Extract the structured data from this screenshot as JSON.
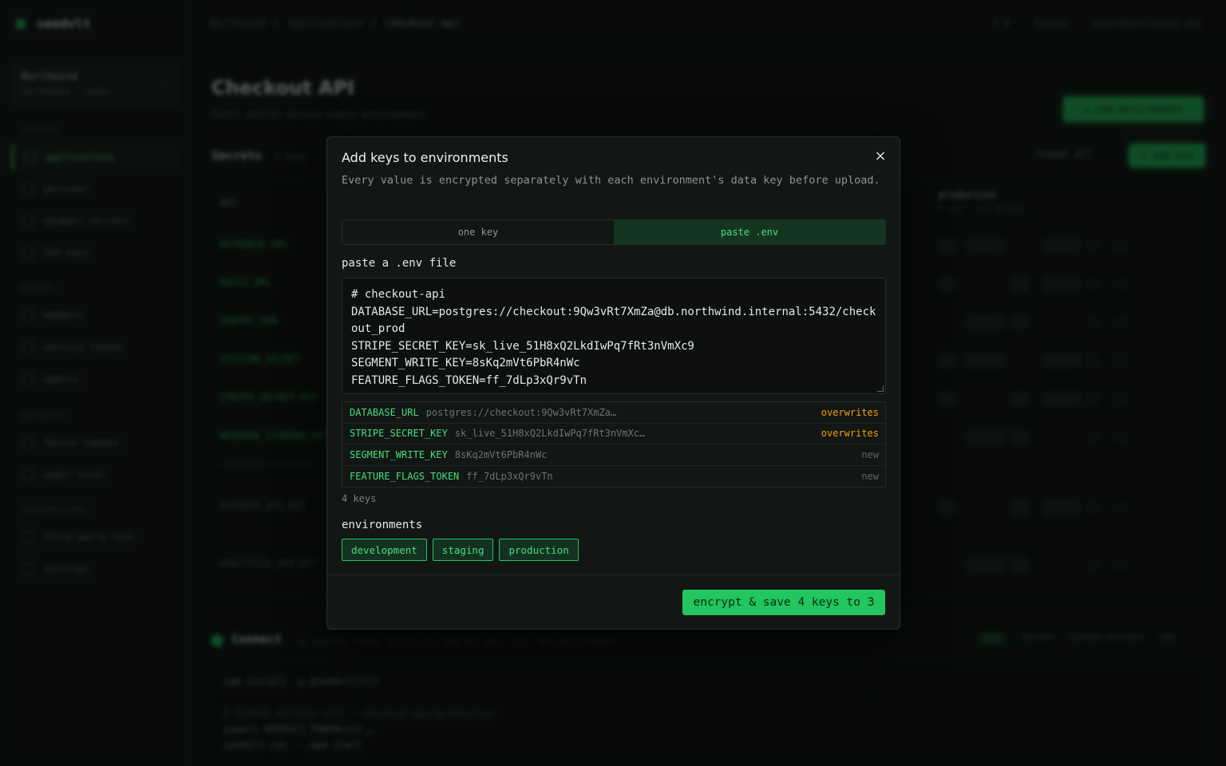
{
  "app": {
    "brand": "seedvlt",
    "org_name": "Northwind",
    "org_sub": "northwind · owner"
  },
  "sidebar": {
    "sections": [
      {
        "title": "SECRETS",
        "items": [
          {
            "label": "applications",
            "active": true
          },
          {
            "label": "personal"
          },
          {
            "label": "dynamic secrets"
          },
          {
            "label": "SSH keys"
          }
        ]
      },
      {
        "title": "ACCESS",
        "items": [
          {
            "label": "members"
          },
          {
            "label": "service tokens"
          },
          {
            "label": "agents"
          }
        ]
      },
      {
        "title": "SECURITY",
        "items": [
          {
            "label": "falcon tokens"
          },
          {
            "label": "audit trail"
          }
        ]
      },
      {
        "title": "INTEGRATIONS",
        "items": [
          {
            "label": "third-party sync"
          },
          {
            "label": "settings"
          }
        ]
      }
    ]
  },
  "topbar": {
    "crumbs": [
      "Northwind",
      "/",
      "applications",
      "/",
      "checkout-api"
    ],
    "right": [
      "⌘ K",
      "tunnel",
      "owner@northwind.dev"
    ]
  },
  "page": {
    "title": "Checkout API",
    "subtitle": "Every secret across every environment.",
    "new_env_button": "+ new environment",
    "secrets_title": "Secrets",
    "secrets_count": "6 keys",
    "reveal_all": "reveal all",
    "add_key_button": "+ add key",
    "table_key_header": "KEY",
    "prod_header": "production",
    "prod_sub": "1 env · 6 / 6 keys",
    "rows": [
      {
        "key": "DATABASE_URL",
        "style": "key"
      },
      {
        "key": "REDIS_URL",
        "style": "key"
      },
      {
        "key": "SENTRY_DSN",
        "style": "key"
      },
      {
        "key": "SESSION_SECRET",
        "style": "key"
      },
      {
        "key": "STRIPE_SECRET_KEY",
        "style": "key"
      },
      {
        "key": "WEBHOOK_SIGNING_KEY",
        "style": "key"
      },
      {
        "key": "inherited from base",
        "style": "note"
      },
      {
        "key": "DATADOG_API_KEY",
        "style": "dim"
      },
      {
        "key": "ANALYTICS_API_KEY",
        "style": "dim"
      }
    ],
    "connect_title": "Connect",
    "connect_sub": "a runtime token (write it) and any env, app, API environment",
    "connect_tabs": [
      "CLI",
      "Docker",
      "GitHub Actions",
      "SDK"
    ],
    "code_lines": [
      {
        "text": "npm install -g @seedvlt/cli",
        "cmt": false
      },
      {
        "text": "",
        "cmt": false
      },
      {
        "text": "# GitHub Actions (CI) → checkout-api/production",
        "cmt": true
      },
      {
        "text": "export SEEDVLT_TOKEN=svt_…",
        "cmt": false
      },
      {
        "text": "seedvlt run -- npm start",
        "cmt": false
      }
    ]
  },
  "modal": {
    "title": "Add keys to environments",
    "close_icon": "×",
    "description": "Every value is encrypted separately with each environment's data key before upload.",
    "tabs": [
      {
        "label": "one key",
        "active": false
      },
      {
        "label": "paste .env",
        "active": true
      }
    ],
    "paste_label": "paste a .env file",
    "env_text": "# checkout-api\nDATABASE_URL=postgres://checkout:9Qw3vRt7XmZa@db.northwind.internal:5432/checkout_prod\nSTRIPE_SECRET_KEY=sk_live_51H8xQ2LkdIwPq7fRt3nVmXc9\nSEGMENT_WRITE_KEY=8sKq2mVt6PbR4nWc\nFEATURE_FLAGS_TOKEN=ff_7dLp3xQr9vTn",
    "preview": [
      {
        "key": "DATABASE_URL",
        "value": "postgres://checkout:9Qw3vRt7XmZa…",
        "status": "overwrites",
        "kind": "over"
      },
      {
        "key": "STRIPE_SECRET_KEY",
        "value": "sk_live_51H8xQ2LkdIwPq7fRt3nVmXc…",
        "status": "overwrites",
        "kind": "over"
      },
      {
        "key": "SEGMENT_WRITE_KEY",
        "value": "8sKq2mVt6PbR4nWc",
        "status": "new",
        "kind": "new"
      },
      {
        "key": "FEATURE_FLAGS_TOKEN",
        "value": "ff_7dLp3xQr9vTn",
        "status": "new",
        "kind": "new"
      }
    ],
    "keys_count": "4 keys",
    "environments_label": "environments",
    "environments": [
      "development",
      "staging",
      "production"
    ],
    "submit_button": "encrypt & save 4 keys to 3"
  },
  "colors": {
    "accent": "#22c55e",
    "accent_text": "#4ade80",
    "warning": "#f59e0b",
    "background": "#0c0f0d",
    "modal": "#121614"
  }
}
